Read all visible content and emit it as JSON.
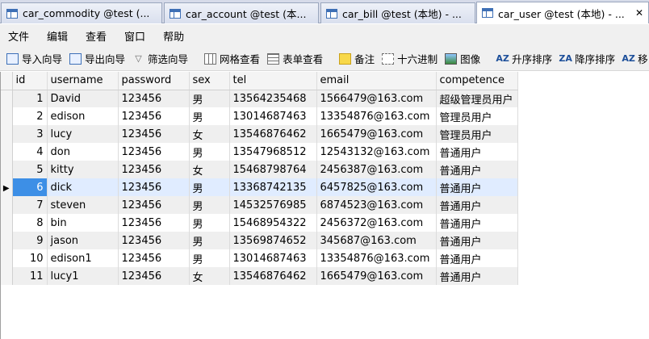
{
  "tabs": [
    {
      "label": "car_commodity @test (..."
    },
    {
      "label": "car_account @test (本..."
    },
    {
      "label": "car_bill @test (本地) - ..."
    },
    {
      "label": "car_user @test (本地) - ..."
    }
  ],
  "menu": [
    "文件",
    "编辑",
    "查看",
    "窗口",
    "帮助"
  ],
  "toolbar": {
    "import_wizard": "导入向导",
    "export_wizard": "导出向导",
    "filter_wizard": "筛选向导",
    "grid_view": "网格查看",
    "form_view": "表单查看",
    "note": "备注",
    "hex": "十六进制",
    "image": "图像",
    "sort_asc": "升序排序",
    "sort_desc": "降序排序",
    "move": "移",
    "sort_asc_icon_text": "AZ",
    "sort_desc_icon_text": "ZA"
  },
  "table": {
    "columns": [
      "id",
      "username",
      "password",
      "sex",
      "tel",
      "email",
      "competence"
    ],
    "rows": [
      [
        "1",
        "David",
        "123456",
        "男",
        "13564235468",
        "1566479@163.com",
        "超级管理员用户"
      ],
      [
        "2",
        "edison",
        "123456",
        "男",
        "13014687463",
        "13354876@163.com",
        "管理员用户"
      ],
      [
        "3",
        "lucy",
        "123456",
        "女",
        "13546876462",
        "1665479@163.com",
        "管理员用户"
      ],
      [
        "4",
        "don",
        "123456",
        "男",
        "13547968512",
        "12543132@163.com",
        "普通用户"
      ],
      [
        "5",
        "kitty",
        "123456",
        "女",
        "15468798764",
        "2456387@163.com",
        "普通用户"
      ],
      [
        "6",
        "dick",
        "123456",
        "男",
        "13368742135",
        "6457825@163.com",
        "普通用户"
      ],
      [
        "7",
        "steven",
        "123456",
        "男",
        "14532576985",
        "6874523@163.com",
        "普通用户"
      ],
      [
        "8",
        "bin",
        "123456",
        "男",
        "15468954322",
        "2456372@163.com",
        "普通用户"
      ],
      [
        "9",
        "jason",
        "123456",
        "男",
        "13569874652",
        "345687@163.com",
        "普通用户"
      ],
      [
        "10",
        "edison1",
        "123456",
        "男",
        "13014687463",
        "13354876@163.com",
        "普通用户"
      ],
      [
        "11",
        "lucy1",
        "123456",
        "女",
        "13546876462",
        "1665479@163.com",
        "普通用户"
      ]
    ],
    "selected_row": 6,
    "pointer_glyph": "▶"
  },
  "colors": {
    "selection": "#3d8fe6",
    "row_highlight": "#e0ecff",
    "alt_row": "#efefef",
    "tab_strip": "#d6dbe9"
  }
}
